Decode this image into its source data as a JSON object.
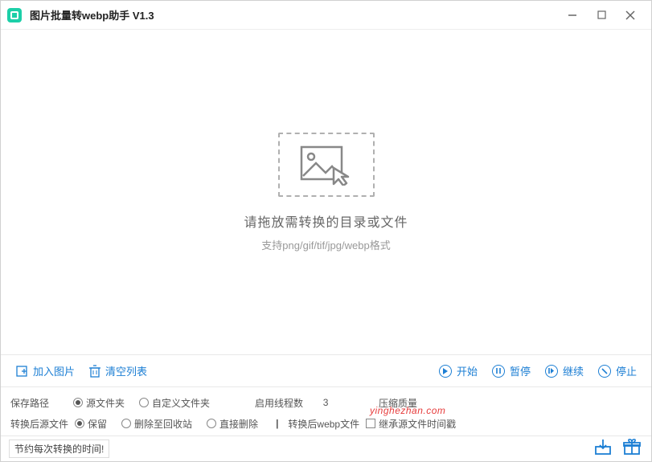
{
  "title": "图片批量转webp助手 V1.3",
  "dropzone": {
    "main": "请拖放需转换的目录或文件",
    "sub": "支持png/gif/tif/jpg/webp格式"
  },
  "toolbar": {
    "add": "加入图片",
    "clear": "清空列表",
    "start": "开始",
    "pause": "暂停",
    "resume": "继续",
    "stop": "停止"
  },
  "settings": {
    "save_path_label": "保存路径",
    "save_src": "源文件夹",
    "save_custom": "自定义文件夹",
    "threads_label": "启用线程数",
    "threads_value": "3",
    "quality_label": "压缩质量",
    "after_label": "转换后源文件",
    "keep": "保留",
    "recycle": "删除至回收站",
    "delete": "直接删除",
    "after_webp_label": "转换后webp文件",
    "inherit_time": "继承源文件时间戳"
  },
  "statusbar": {
    "text": "节约每次转换的时间!"
  },
  "watermark": "yinghezhan.com"
}
